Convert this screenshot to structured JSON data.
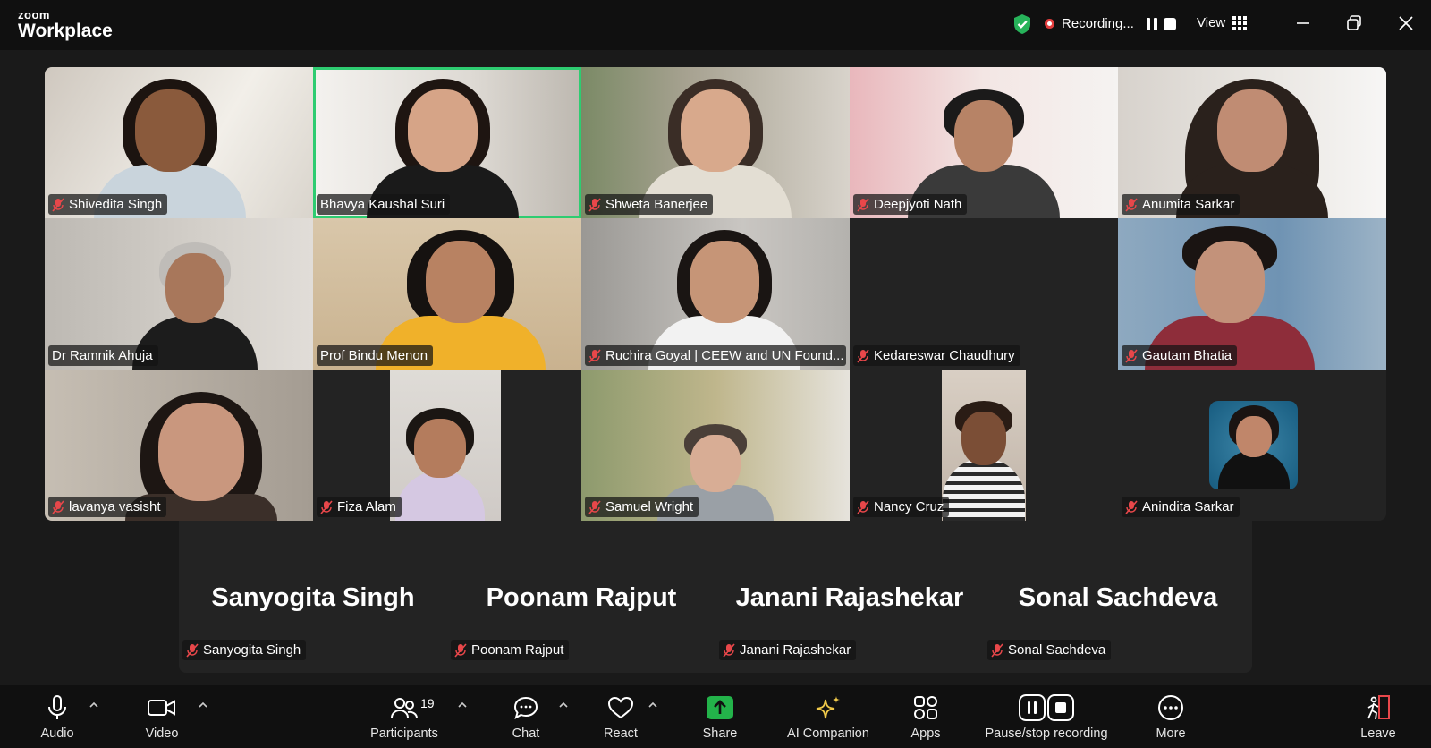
{
  "app": {
    "logo_top": "zoom",
    "logo_bottom": "Workplace"
  },
  "header": {
    "recording_label": "Recording...",
    "view_label": "View"
  },
  "colors": {
    "active_speaker_border": "#2ecc71",
    "mic_muted": "#e8474a",
    "shield": "#27b35a",
    "share_button": "#23b34a",
    "leave": "#e8474a"
  },
  "participants_video": [
    {
      "name": "Shivedita Singh",
      "muted": true
    },
    {
      "name": "Bhavya Kaushal Suri",
      "muted": false,
      "active_speaker": true
    },
    {
      "name": "Shweta Banerjee",
      "muted": true
    },
    {
      "name": "Deepjyoti Nath",
      "muted": true
    },
    {
      "name": "Anumita Sarkar",
      "muted": true
    },
    {
      "name": "Dr Ramnik Ahuja",
      "muted": false
    },
    {
      "name": "Prof Bindu Menon",
      "muted": false
    },
    {
      "name": "Ruchira Goyal | CEEW and UN Found...",
      "muted": true
    },
    {
      "name": "Kedareswar Chaudhury",
      "muted": true,
      "video_off": true
    },
    {
      "name": "Gautam Bhatia",
      "muted": true
    },
    {
      "name": "lavanya vasisht",
      "muted": true
    },
    {
      "name": "Fiza Alam",
      "muted": true
    },
    {
      "name": "Samuel Wright",
      "muted": true
    },
    {
      "name": "Nancy Cruz",
      "muted": true
    },
    {
      "name": "Anindita Sarkar",
      "muted": true,
      "profile_picture": true
    }
  ],
  "participants_no_video": [
    {
      "display": "Sanyogita Singh",
      "name": "Sanyogita Singh"
    },
    {
      "display": "Poonam Rajput",
      "name": "Poonam Rajput"
    },
    {
      "display": "Janani Rajashekar",
      "name": "Janani Rajashekar"
    },
    {
      "display": "Sonal Sachdeva",
      "name": "Sonal Sachdeva"
    }
  ],
  "toolbar": {
    "audio": "Audio",
    "video": "Video",
    "participants": "Participants",
    "participants_count": "19",
    "chat": "Chat",
    "react": "React",
    "share": "Share",
    "ai_companion": "AI Companion",
    "apps": "Apps",
    "pause_stop_recording": "Pause/stop recording",
    "more": "More",
    "leave": "Leave"
  }
}
